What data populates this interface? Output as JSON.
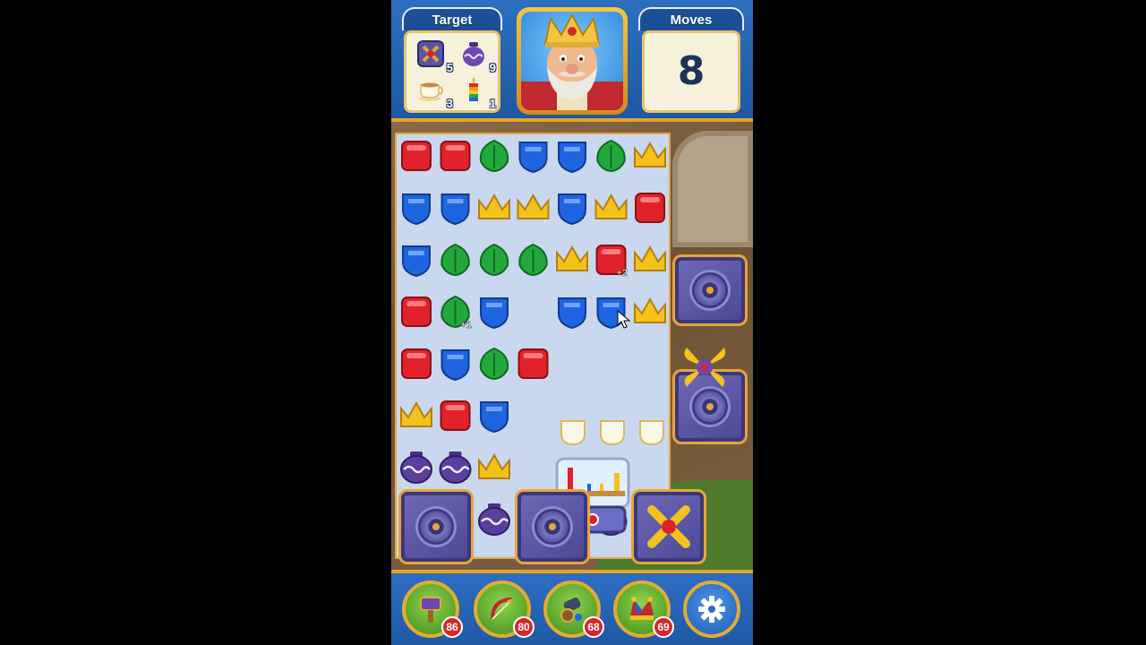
{
  "header": {
    "target_label": "Target",
    "moves_label": "Moves",
    "moves_value": "8",
    "goals": [
      {
        "icon": "crossed-tile-icon",
        "count": "5"
      },
      {
        "icon": "purple-pot-icon",
        "count": "9"
      },
      {
        "icon": "teacup-icon",
        "count": "3"
      },
      {
        "icon": "rainbow-candle-icon",
        "count": "1"
      }
    ],
    "character": "king-portrait"
  },
  "board": {
    "tiles": [
      [
        "red",
        "red",
        "green",
        "blue",
        "blue",
        "green",
        "yellow"
      ],
      [
        "blue",
        "blue",
        "yellow",
        "yellow",
        "blue",
        "yellow",
        "red"
      ],
      [
        "blue",
        "green",
        "green",
        "green",
        "yellow",
        "red",
        "yellow"
      ],
      [
        "red",
        "green",
        "blue",
        "",
        "blue",
        "blue",
        "yellow"
      ],
      [
        "red",
        "blue",
        "green",
        "red",
        "",
        "",
        ""
      ],
      [
        "yellow",
        "red",
        "blue",
        "",
        "",
        "",
        ""
      ],
      [
        "pot",
        "pot",
        "yellow",
        "",
        "",
        "",
        ""
      ],
      [
        "pot",
        "pot",
        "pot",
        "pot",
        "pot",
        "pot",
        "pot"
      ]
    ],
    "badges": [
      "+2",
      "+1"
    ],
    "colors": {
      "red": "#e1222b",
      "blue": "#1f64e0",
      "green": "#23a83c",
      "yellow": "#f3c21d",
      "pot": "#5b3f9e",
      "cell": "#c9d8ee"
    }
  },
  "boosters": [
    {
      "name": "hammer",
      "icon": "hammer-icon",
      "count": "86"
    },
    {
      "name": "arrow",
      "icon": "bow-arrow-icon",
      "count": "80"
    },
    {
      "name": "cannon",
      "icon": "cannon-icon",
      "count": "68"
    },
    {
      "name": "jester",
      "icon": "jester-hat-icon",
      "count": "69"
    }
  ],
  "settings": {
    "icon": "gear-icon"
  }
}
